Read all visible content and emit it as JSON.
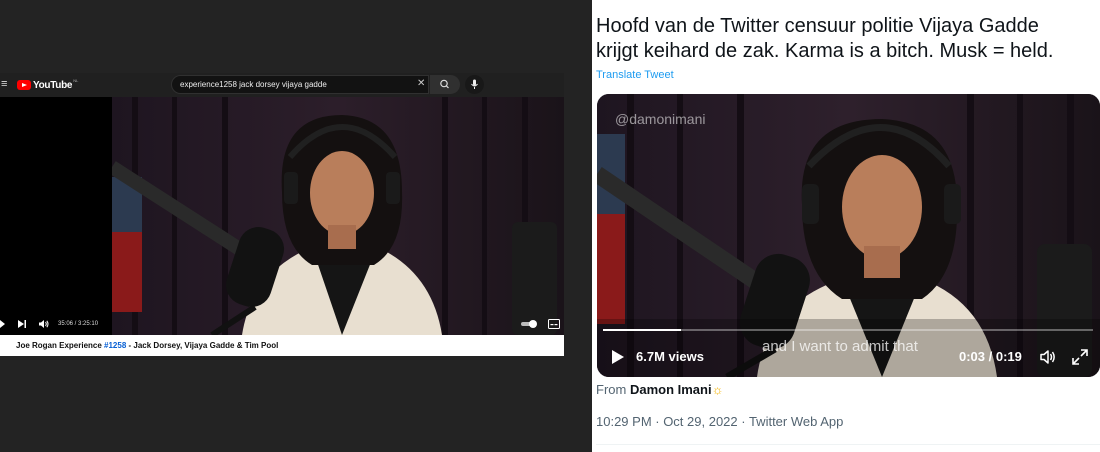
{
  "youtube": {
    "logo_text": "YouTube",
    "logo_region": "NL",
    "search_query": "experience1258 jack dorsey vijaya gadde",
    "time_display": "35:06 / 3:25:10",
    "progress_fraction": 0.171,
    "title_prefix": "Joe Rogan Experience ",
    "title_hashtag": "#1258",
    "title_suffix": " - Jack Dorsey, Vijaya Gadde & Tim Pool",
    "colors": {
      "accent": "#ff0000",
      "hashtag": "#065fd4"
    }
  },
  "tweet": {
    "text_line1": "Hoofd van de Twitter censuur politie Vijaya Gadde",
    "text_line2": "krijgt keihard de zak. Karma is a bitch. Musk = held.",
    "translate_label": "Translate Tweet",
    "video": {
      "watermark": "@damonimani",
      "views": "6.7M views",
      "caption": "and I want to admit that",
      "time": "0:03 / 0:19",
      "progress_fraction": 0.16
    },
    "from_prefix": "From ",
    "from_name": "Damon Imani",
    "from_emoji": "☼",
    "timestamp": "10:29 PM · Oct 29, 2022 · Twitter Web App",
    "colors": {
      "link": "#1d9bf0",
      "text": "#0f1419",
      "muted": "#536471"
    }
  }
}
